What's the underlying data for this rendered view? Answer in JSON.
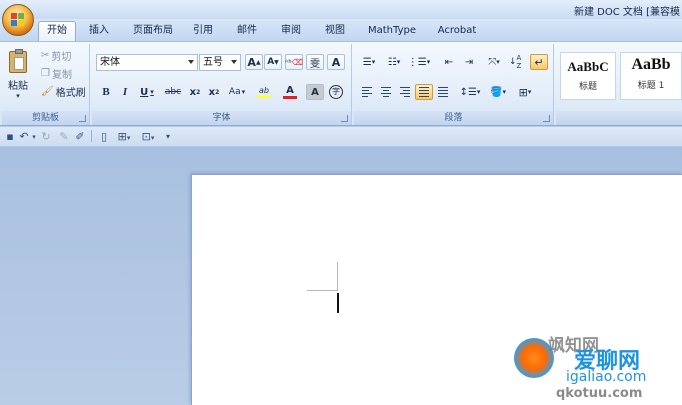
{
  "window": {
    "title": "新建 DOC 文档 [兼容模"
  },
  "tabs": [
    {
      "label": "开始",
      "active": true
    },
    {
      "label": "插入"
    },
    {
      "label": "页面布局"
    },
    {
      "label": "引用"
    },
    {
      "label": "邮件"
    },
    {
      "label": "审阅"
    },
    {
      "label": "视图"
    },
    {
      "label": "MathType"
    },
    {
      "label": "Acrobat"
    }
  ],
  "clipboard": {
    "paste_label": "粘贴",
    "cut_label": "剪切",
    "copy_label": "复制",
    "format_painter_label": "格式刷",
    "group_label": "剪贴板"
  },
  "font": {
    "font_name": "宋体",
    "font_size": "五号",
    "grow_label": "A",
    "shrink_label": "A",
    "bold": "B",
    "italic": "I",
    "underline": "U",
    "strike": "abc",
    "subscript": "x",
    "superscript": "x",
    "change_case": "Aa",
    "highlight_label": "ab",
    "font_color_label": "A",
    "shading_label": "A",
    "encircle_label": "字",
    "group_label": "字体"
  },
  "paragraph": {
    "group_label": "段落"
  },
  "styles": [
    {
      "sample": "AaBbC",
      "name": "标题"
    },
    {
      "sample": "AaBb",
      "name": "标题 1"
    }
  ],
  "watermark": {
    "main": "爱聊网",
    "url": "igaliao.com",
    "prefix": "飒知网",
    "bottom": "qkotuu.com"
  },
  "colors": {
    "accent": "#f3b640",
    "ribbon": "#e6eff9",
    "workspace": "#b9cde6",
    "font_color": "#e02020",
    "highlight": "#ffff40"
  }
}
